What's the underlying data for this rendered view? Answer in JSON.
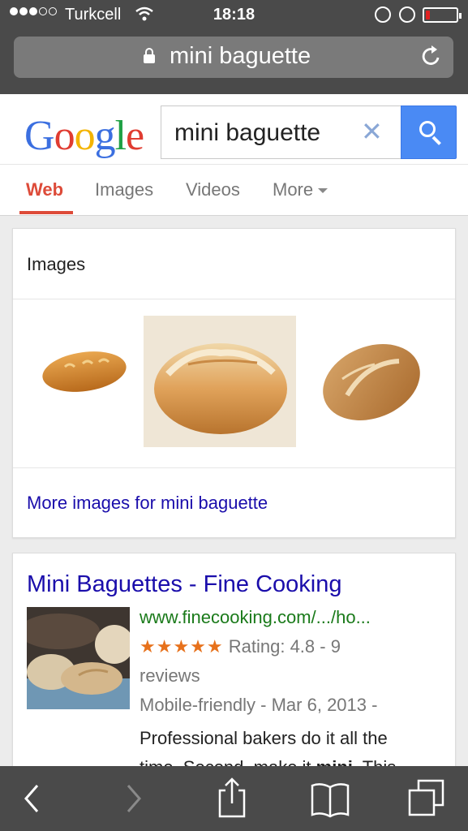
{
  "status": {
    "carrier": "Turkcell",
    "time": "18:18",
    "signal_bars_filled": 3,
    "signal_bars_total": 5,
    "battery_level": 0.15,
    "battery_color": "#e02020"
  },
  "address_bar": {
    "url": "mini baguette",
    "lock_icon": "lock-icon",
    "reload_icon": "reload-icon"
  },
  "google": {
    "logo": {
      "letters": [
        "G",
        "o",
        "o",
        "g",
        "l",
        "e"
      ],
      "colors": [
        "#3b6fe0",
        "#e03c31",
        "#f4b400",
        "#3b6fe0",
        "#1fa045",
        "#e03c31"
      ]
    },
    "search": {
      "query": "mini baguette",
      "clear_symbol": "✕",
      "button_color": "#4a8af4"
    },
    "tabs": [
      {
        "label": "Web",
        "active": true
      },
      {
        "label": "Images",
        "active": false
      },
      {
        "label": "Videos",
        "active": false
      },
      {
        "label": "More",
        "active": false
      }
    ]
  },
  "images_card": {
    "title": "Images",
    "more_link": "More images for mini baguette"
  },
  "result": {
    "title": "Mini Baguettes - Fine Cooking",
    "url": "www.finecooking.com/.../ho...",
    "stars": "★★★★★",
    "rating_text": "Rating: 4.8 - 9",
    "reviews_text": "reviews",
    "meta": "Mobile-friendly - Mar 6, 2013 -",
    "snippet_1": "Professional bakers do it all the",
    "snippet_2a": "time. Second, make it ",
    "snippet_2b": "mini",
    "snippet_2c": ". This"
  },
  "toolbar": {
    "back_icon": "back-icon",
    "forward_icon": "forward-icon",
    "share_icon": "share-icon",
    "bookmarks_icon": "bookmarks-icon",
    "tabs_icon": "tabs-icon"
  }
}
